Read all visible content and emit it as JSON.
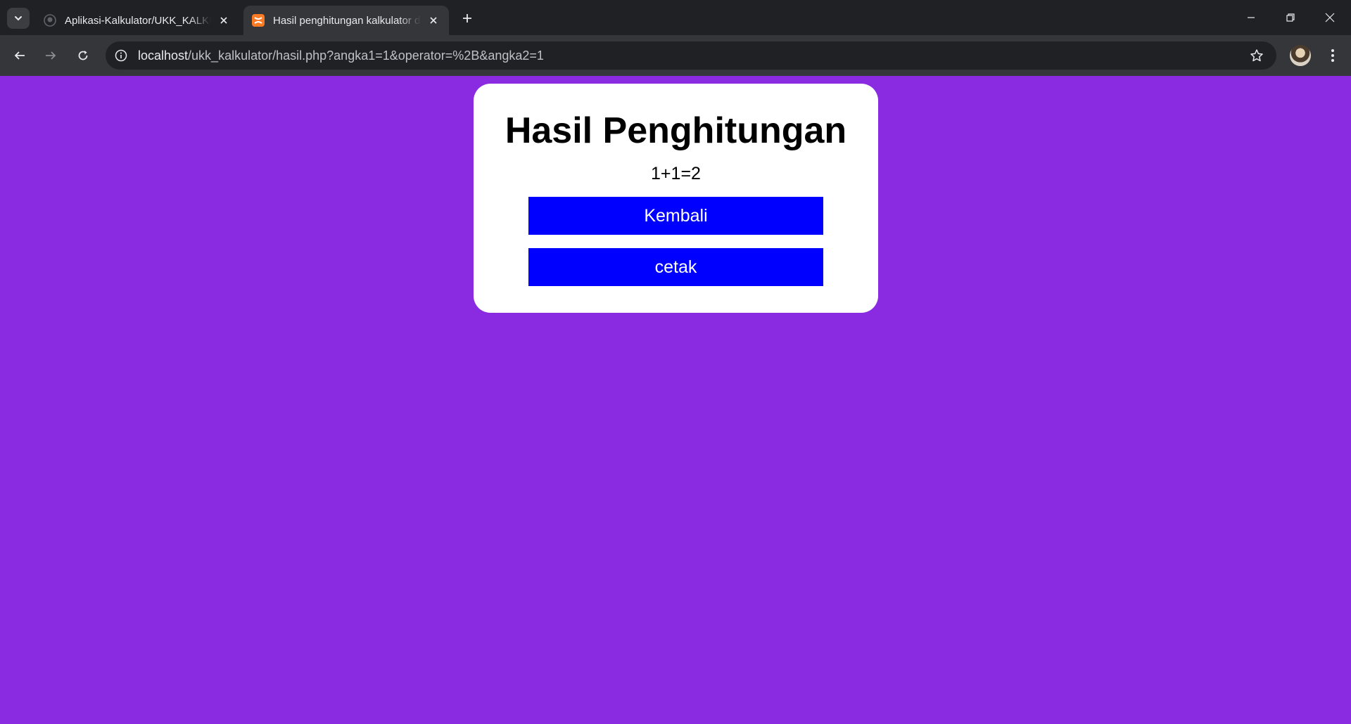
{
  "browser": {
    "tabs": [
      {
        "title": "Aplikasi-Kalkulator/UKK_KALKULATOR",
        "favicon": "github-icon",
        "active": false
      },
      {
        "title": "Hasil penghitungan kalkulator dan cetak",
        "favicon": "xampp-icon",
        "active": true
      }
    ],
    "url_host": "localhost",
    "url_path": "/ukk_kalkulator/hasil.php?angka1=1&operator=%2B&angka2=1"
  },
  "page": {
    "background_color": "#8a2be2",
    "title": "Hasil Penghitungan",
    "result": "1+1=2",
    "back_button": "Kembali",
    "print_button": "cetak",
    "button_color": "#0000ff"
  }
}
